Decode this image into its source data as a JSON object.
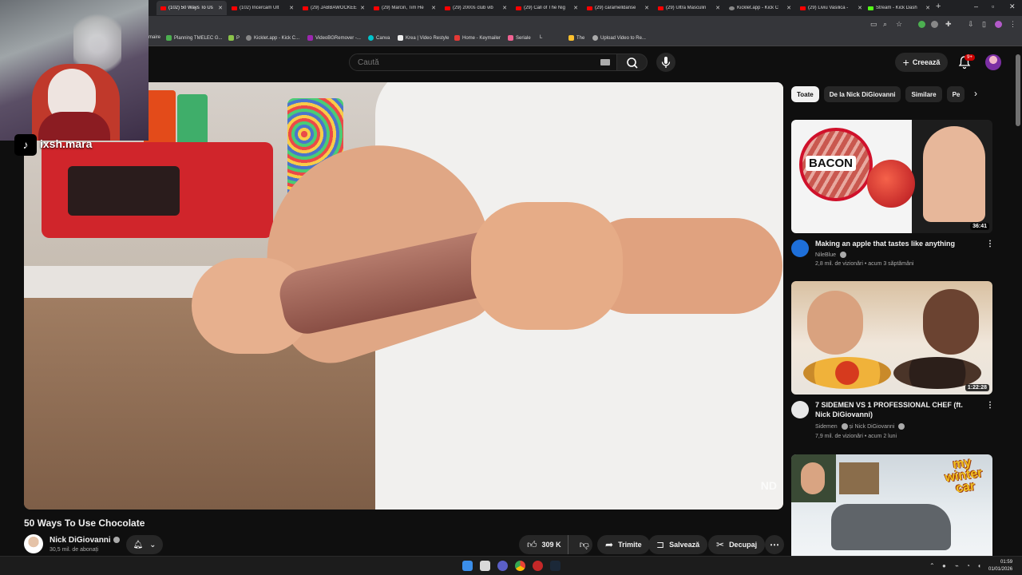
{
  "browser": {
    "tabs": [
      {
        "title": "(102) 50 Ways To Us",
        "active": true,
        "favicon": "youtube-icon"
      },
      {
        "title": "(102) Încercăm Ult",
        "favicon": "youtube-icon"
      },
      {
        "title": "(29) JABBAWOCKEE",
        "favicon": "youtube-icon"
      },
      {
        "title": "(29) Marcin, Tim He",
        "favicon": "youtube-icon"
      },
      {
        "title": "(29) 2000s club vib",
        "favicon": "youtube-icon"
      },
      {
        "title": "(29) Call of The Nig",
        "favicon": "youtube-icon"
      },
      {
        "title": "(29) caramelldanse",
        "favicon": "youtube-icon"
      },
      {
        "title": "(29) Ultra Masculin",
        "favicon": "youtube-icon"
      },
      {
        "title": "Kicklet.app - Kick C",
        "favicon": "kicklet-icon"
      },
      {
        "title": "(29) Liviu Vasilica -",
        "favicon": "youtube-icon"
      },
      {
        "title": "Stream - Kick Dash",
        "favicon": "kick-icon"
      }
    ],
    "new_tab": "+",
    "bookmarks": [
      {
        "label": "maire"
      },
      {
        "label": "Planning TMELEC G..."
      },
      {
        "label": "P"
      },
      {
        "label": "Kicklet.app - Kick C..."
      },
      {
        "label": "VideoBGRemover -..."
      },
      {
        "label": "Canva"
      },
      {
        "label": "Krea | Video Restyle"
      },
      {
        "label": "Home - Keymailer"
      },
      {
        "label": "Seriale"
      },
      {
        "label": "L"
      },
      {
        "label": "The"
      },
      {
        "label": "Upload Video to Re..."
      }
    ]
  },
  "webcam": {
    "handle": "ixsh.mara",
    "platform_icon": "tiktok-icon"
  },
  "header": {
    "search_placeholder": "Caută",
    "create_label": "Creează",
    "notifications_badge": "9+"
  },
  "video": {
    "title": "50 Ways To Use Chocolate",
    "watermark": "ND",
    "channel_name": "Nick DiGiovanni",
    "subscribers": "30,5 mil. de abonați",
    "likes": "309 K",
    "share_label": "Trimite",
    "save_label": "Salvează",
    "clip_label": "Decupaj"
  },
  "chips": [
    {
      "label": "Toate",
      "active": true
    },
    {
      "label": "De la Nick DiGiovanni"
    },
    {
      "label": "Similare"
    },
    {
      "label": "Pe"
    }
  ],
  "recommendations": [
    {
      "title": "Making an apple that tastes like anything",
      "channel": "NileBlue",
      "meta": "2,8 mil. de vizionări • acum 3 săptămâni",
      "duration": "36:41",
      "thumb_text": "BACON"
    },
    {
      "title": "7 SIDEMEN VS 1 PROFESSIONAL CHEF (ft. Nick DiGiovanni)",
      "channel": "Sidemen",
      "channel_extra": "și Nick DiGiovanni",
      "meta": "7,9 mil. de vizionări • acum 2 luni",
      "duration": "1:22:28"
    },
    {
      "title": "",
      "thumb_text": "my winter car"
    }
  ],
  "taskbar": {
    "time": "01:59",
    "date": "01/01/2026"
  }
}
